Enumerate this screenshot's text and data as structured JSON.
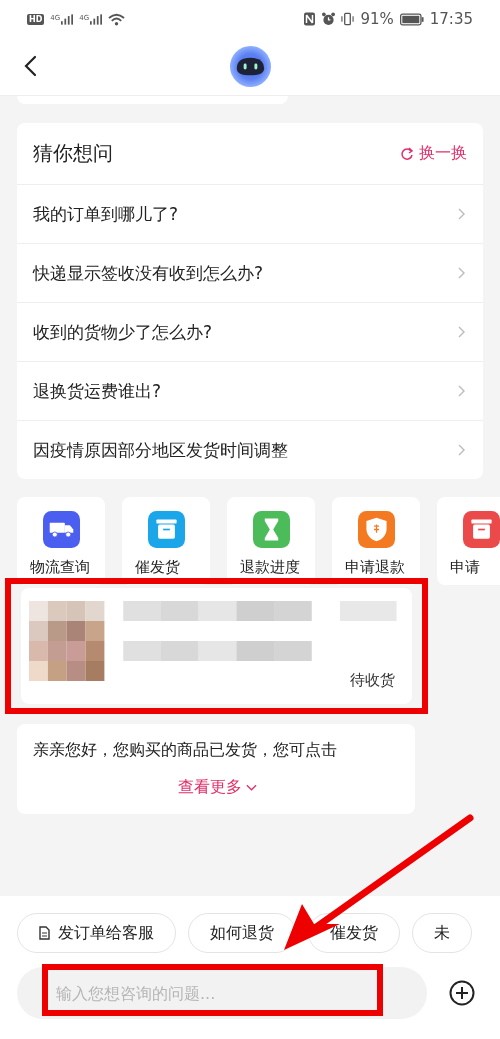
{
  "status_bar": {
    "hd": "HD",
    "network_1": "4G",
    "network_2": "4G",
    "battery": "91%",
    "time": "17:35"
  },
  "suggestions": {
    "title": "猜你想问",
    "refresh": "换一换",
    "questions": [
      {
        "text": "我的订单到哪儿了?"
      },
      {
        "text": "快递显示签收没有收到怎么办?"
      },
      {
        "text": "收到的货物少了怎么办?"
      },
      {
        "text": "退换货运费谁出?"
      },
      {
        "text": "因疫情原因部分地区发货时间调整"
      }
    ]
  },
  "quick_actions": [
    {
      "label": "物流查询",
      "kind": "truck",
      "color": "#4a5ef0"
    },
    {
      "label": "催发货",
      "kind": "box",
      "color": "#1aa6e8"
    },
    {
      "label": "退款进度",
      "kind": "hourglass",
      "color": "#4cbb5a"
    },
    {
      "label": "申请退款",
      "kind": "shield",
      "color": "#f47a22"
    },
    {
      "label": "申请",
      "kind": "box",
      "color": "#ea4a4a"
    }
  ],
  "order_card": {
    "status": "待收货",
    "highlighted": true
  },
  "message": {
    "text": "亲亲您好，您购买的商品已发货，您可点击",
    "more": "查看更多"
  },
  "chips": [
    {
      "label": "发订单给客服",
      "kind": "document"
    },
    {
      "label": "如何退货",
      "kind": "plain"
    },
    {
      "label": "催发货",
      "kind": "plain"
    },
    {
      "label": "未",
      "kind": "plain"
    }
  ],
  "input": {
    "placeholder": "输入您想咨询的问题...",
    "highlighted": true
  },
  "annotations": [
    {
      "kind": "arrow"
    }
  ]
}
